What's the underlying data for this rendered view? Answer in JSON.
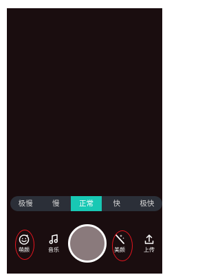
{
  "speed": {
    "options": [
      "极慢",
      "慢",
      "正常",
      "快",
      "极快"
    ],
    "selected": "正常"
  },
  "toolbar": {
    "beauty_label": "萌颜",
    "music_label": "音乐",
    "filter_label": "美颜",
    "upload_label": "上传"
  },
  "colors": {
    "accent": "#18c8b4",
    "preview": "#1a0d0f",
    "annotation": "#e8141e"
  },
  "icons": {
    "beauty": "smiley-face-icon",
    "music": "music-note-icon",
    "filter": "magic-wand-icon",
    "upload": "upload-arrow-icon"
  }
}
